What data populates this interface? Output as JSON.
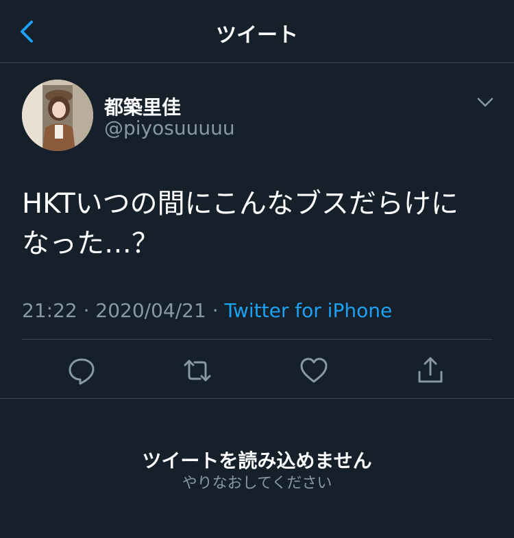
{
  "header": {
    "title": "ツイート",
    "back_icon": "chevron-left-icon"
  },
  "tweet": {
    "author": {
      "display_name": "都築里佳",
      "handle": "@piyosuuuuu"
    },
    "text": "HKTいつの間にこんなブスだらけに\nなった…？",
    "time": "21:22",
    "date": "2020/04/21",
    "separator": "·",
    "source": "Twitter for iPhone",
    "actions": [
      "reply-icon",
      "retweet-icon",
      "like-icon",
      "share-icon"
    ]
  },
  "error": {
    "title": "ツイートを読み込めません",
    "subtitle": "やりなおしてください"
  },
  "colors": {
    "background": "#15202b",
    "divider": "#38444d",
    "accent": "#1da1f2",
    "secondary_text": "#8899a6"
  }
}
